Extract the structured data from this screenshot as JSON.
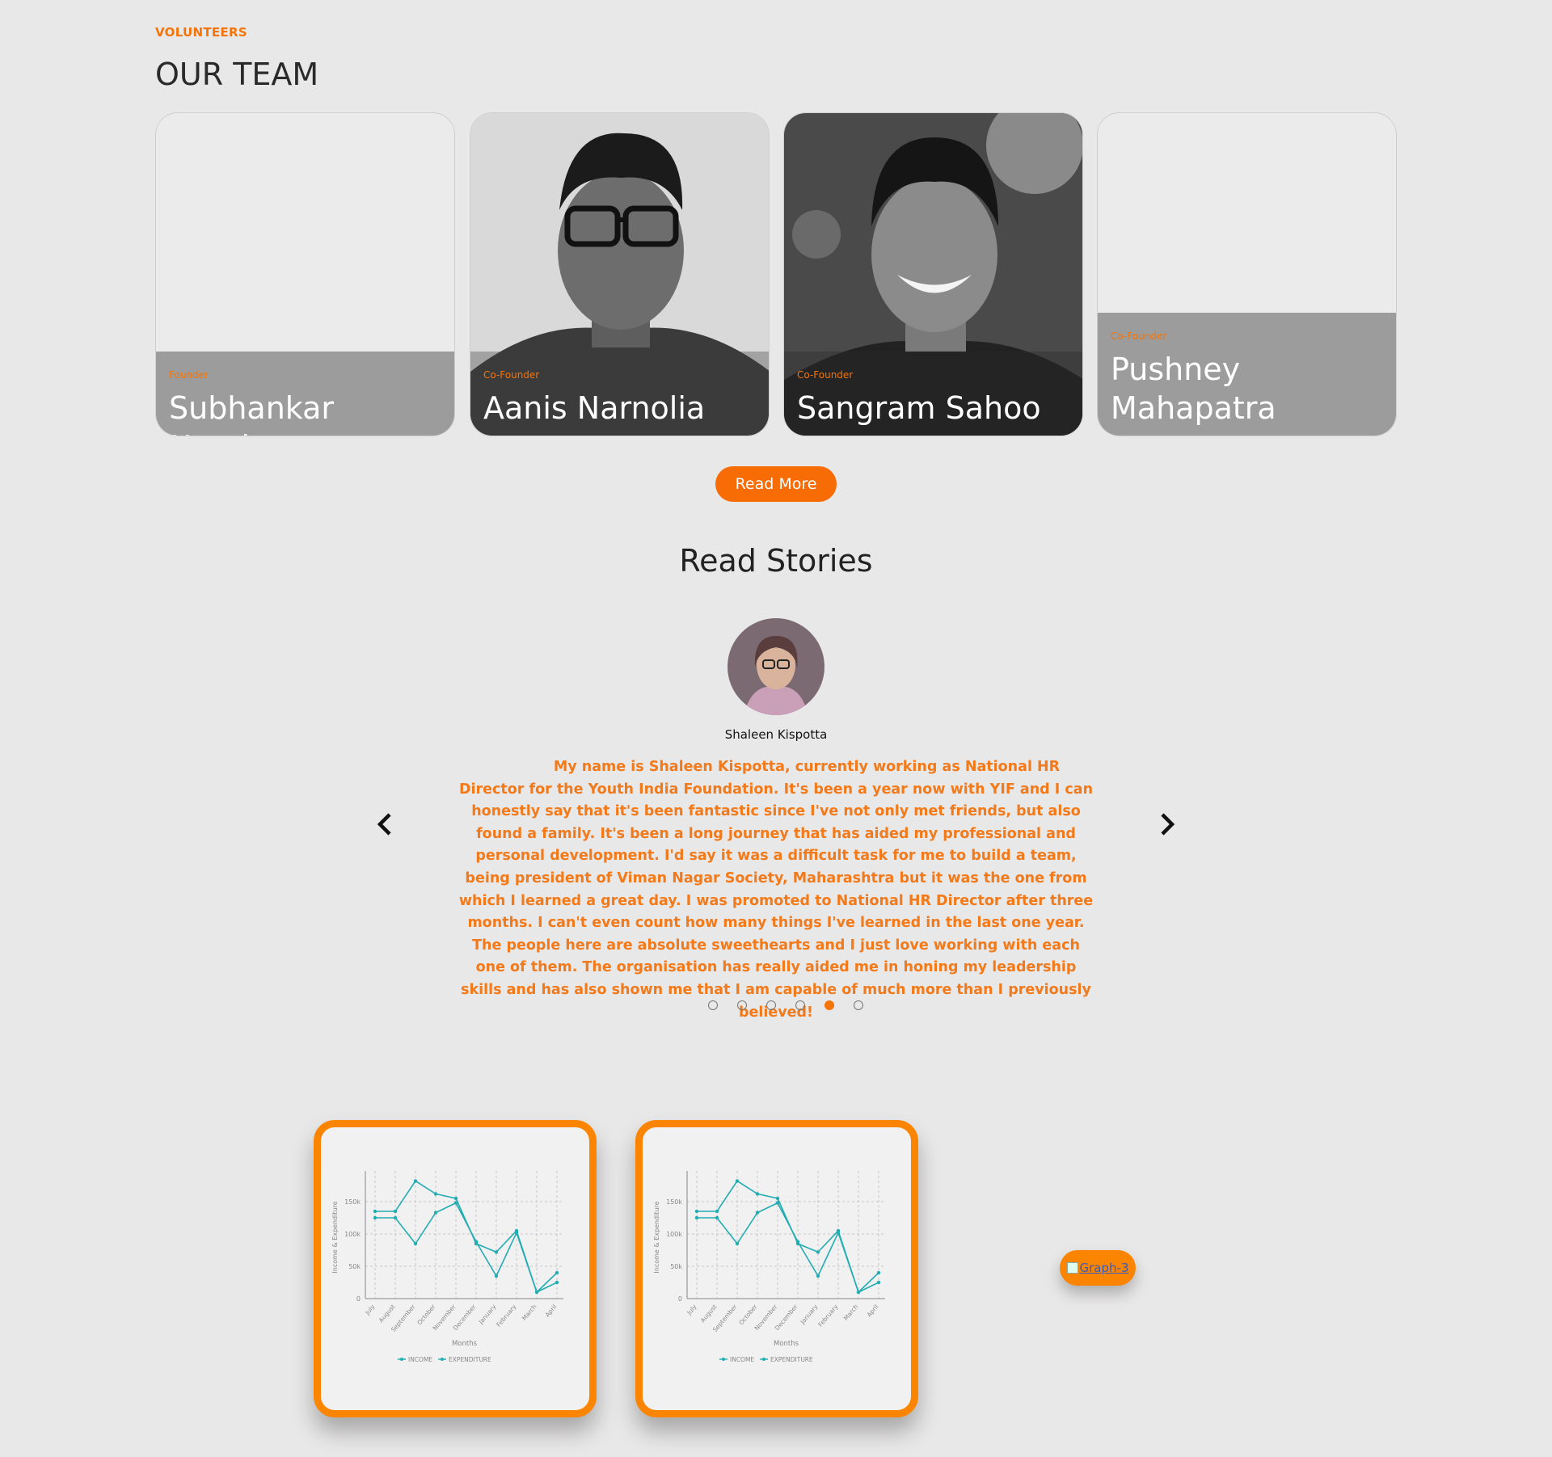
{
  "team": {
    "eyebrow": "VOLUNTEERS",
    "title": "OUR TEAM",
    "members": [
      {
        "role": "Founder",
        "name": "Subhankar Nanda"
      },
      {
        "role": "Co-Founder",
        "name": "Aanis Narnolia"
      },
      {
        "role": "Co-Founder",
        "name": "Sangram Sahoo"
      },
      {
        "role": "Co-Founder",
        "name": "Pushney Mahapatra"
      }
    ],
    "read_more": "Read More"
  },
  "stories": {
    "title": "Read Stories",
    "name": "Shaleen Kispotta",
    "text": "My name is Shaleen Kispotta, currently working as National HR Director for the Youth India Foundation. It's been a year now with YIF and I can honestly say that it's been fantastic since I've not only met friends, but also found a family. It's been a long journey that has aided my professional and personal development. I'd say it was a difficult task for me to build a team, being president of Viman Nagar Society, Maharashtra but it was the one from which I learned a great day. I was promoted to National HR Director after three months. I can't even count how many things I've learned in the last one year. The people here are absolute sweethearts and I just love working with each one of them. The organisation has really aided me in honing my leadership skills and has also shown me that I am capable of much more than I previously believed!",
    "dot_count": 6,
    "active_dot": 5
  },
  "graph_link_alt": "Graph-3",
  "colors": {
    "accent": "#f57408",
    "line": "#22adb3"
  },
  "chart_data": [
    {
      "type": "line",
      "x": [
        "July",
        "August",
        "September",
        "October",
        "November",
        "December",
        "January",
        "February",
        "March",
        "April"
      ],
      "series": [
        {
          "name": "INCOME",
          "values": [
            135000,
            135000,
            182000,
            162000,
            155000,
            85000,
            72000,
            105000,
            10000,
            40000
          ]
        },
        {
          "name": "EXPENDITURE",
          "values": [
            125000,
            125000,
            85000,
            133000,
            148000,
            88000,
            35000,
            102000,
            10000,
            25000
          ]
        }
      ],
      "yticks": [
        "0",
        "50k",
        "100k",
        "150k"
      ],
      "xlabel": "Months",
      "ylabel": "Income & Expenditure",
      "ylim": [
        0,
        190000
      ]
    },
    {
      "type": "line",
      "x": [
        "July",
        "August",
        "September",
        "October",
        "November",
        "December",
        "January",
        "February",
        "March",
        "April"
      ],
      "series": [
        {
          "name": "INCOME",
          "values": [
            135000,
            135000,
            182000,
            162000,
            155000,
            85000,
            72000,
            105000,
            10000,
            40000
          ]
        },
        {
          "name": "EXPENDITURE",
          "values": [
            125000,
            125000,
            85000,
            133000,
            148000,
            88000,
            35000,
            102000,
            10000,
            25000
          ]
        }
      ],
      "yticks": [
        "0",
        "50k",
        "100k",
        "150k"
      ],
      "xlabel": "Months",
      "ylabel": "Income & Expenditure",
      "ylim": [
        0,
        190000
      ]
    }
  ]
}
